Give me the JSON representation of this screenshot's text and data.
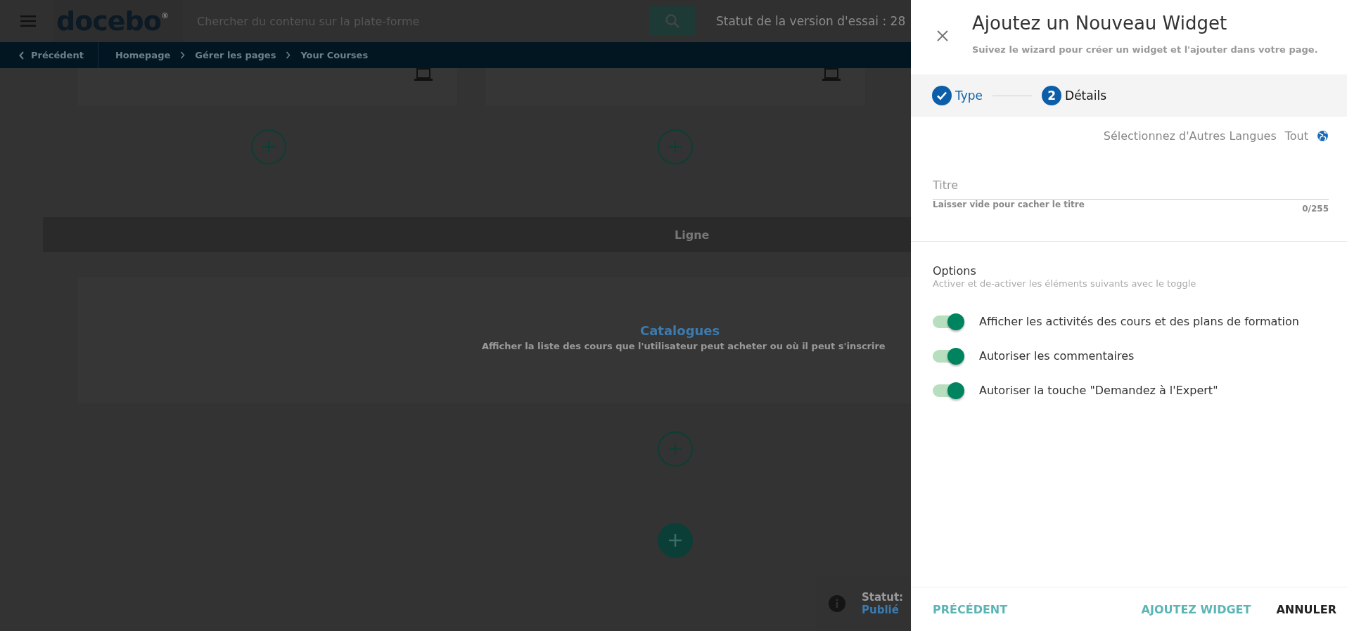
{
  "header": {
    "logo": "docebo",
    "logo_mark": "®",
    "search": {
      "placeholder": "Chercher du contenu sur la plate-forme"
    },
    "trial_status": "Statut de la version d'essai : 28"
  },
  "breadcrumb": {
    "back": "Précédent",
    "items": [
      "Homepage",
      "Gérer les pages",
      "Your Courses"
    ]
  },
  "canvas": {
    "row_label": "Ligne",
    "widget": {
      "title": "Catalogues",
      "description": "Afficher la liste des cours que l'utilisateur peut acheter ou où il peut s'inscrire"
    },
    "status_label": "Statut:",
    "status_value": "Publié"
  },
  "panel": {
    "title": "Ajoutez un Nouveau Widget",
    "subtitle": "Suivez le wizard pour créer un widget et l'ajouter dans votre page.",
    "steps": [
      {
        "label": "Type",
        "completed": true,
        "selected": false
      },
      {
        "number": "2",
        "label": "Détails",
        "completed": false,
        "selected": true
      }
    ],
    "languages": {
      "label": "Sélectionnez d'Autres Langues",
      "value": "Tout"
    },
    "title_field": {
      "placeholder": "Titre",
      "helper": "Laisser vide pour cacher le titre",
      "counter": "0/255"
    },
    "options": {
      "heading": "Options",
      "hint": "Activer et de-activer les éléments suivants avec le toggle",
      "toggles": [
        {
          "label": "Afficher les activités des cours et des plans de formation",
          "on": true
        },
        {
          "label": "Autoriser les commentaires",
          "on": true
        },
        {
          "label": "Autoriser la touche \"Demandez à l'Expert\"",
          "on": true
        }
      ]
    },
    "footer": {
      "back": "PRÉCÉDENT",
      "add": "AJOUTEZ WIDGET",
      "cancel": "ANNULER"
    }
  }
}
